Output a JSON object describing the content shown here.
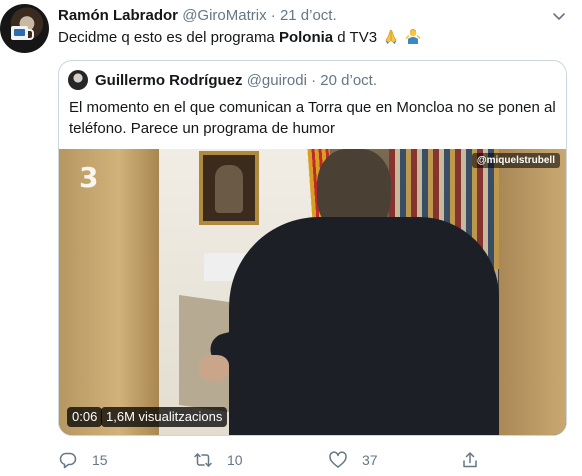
{
  "tweet": {
    "author_name": "Ramón Labrador",
    "author_handle": "@GiroMatrix",
    "separator": "·",
    "time": "21 d’oct.",
    "text_before": "Decidme q esto es del programa ",
    "text_bold": "Polonia",
    "text_after": " d TV3",
    "emojis": [
      "folded-hands-emoji",
      "person-shrugging-emoji"
    ]
  },
  "quoted": {
    "author_name": "Guillermo Rodríguez",
    "author_handle": "@guirodi",
    "separator": "·",
    "time": "20 d’oct.",
    "text": "El momento en el que comunican a Torra que en Moncloa no se ponen al teléfono. Parece un programa de humor",
    "video": {
      "channel_logo": "3",
      "watermark": "@miquelstrubell",
      "duration": "0:06",
      "views": "1,6M visualitzacions"
    }
  },
  "actions": {
    "reply_count": "15",
    "retweet_count": "10",
    "like_count": "37"
  },
  "icons": [
    "caret-down-icon",
    "reply-icon",
    "retweet-icon",
    "like-icon",
    "share-icon"
  ],
  "colors": {
    "text": "#14171a",
    "muted": "#657786",
    "border": "#ccd6dd"
  }
}
